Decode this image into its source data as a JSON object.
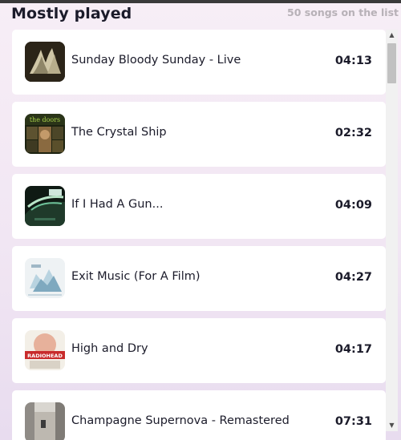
{
  "header": {
    "title": "Mostly played",
    "count": "50 songs on the list"
  },
  "songs": [
    {
      "title": "Sunday Bloody Sunday - Live",
      "duration": "04:13"
    },
    {
      "title": "The Crystal Ship",
      "duration": "02:32",
      "art_text": "the doors"
    },
    {
      "title": "If I Had A Gun...",
      "duration": "04:09"
    },
    {
      "title": "Exit Music (For A Film)",
      "duration": "04:27"
    },
    {
      "title": "High and Dry",
      "duration": "04:17",
      "art_text": "RADIOHEAD"
    },
    {
      "title": "Champagne Supernova - Remastered",
      "duration": "07:31"
    }
  ],
  "scrollbar": {
    "up_icon": "triangle-up",
    "down_icon": "triangle-down"
  }
}
